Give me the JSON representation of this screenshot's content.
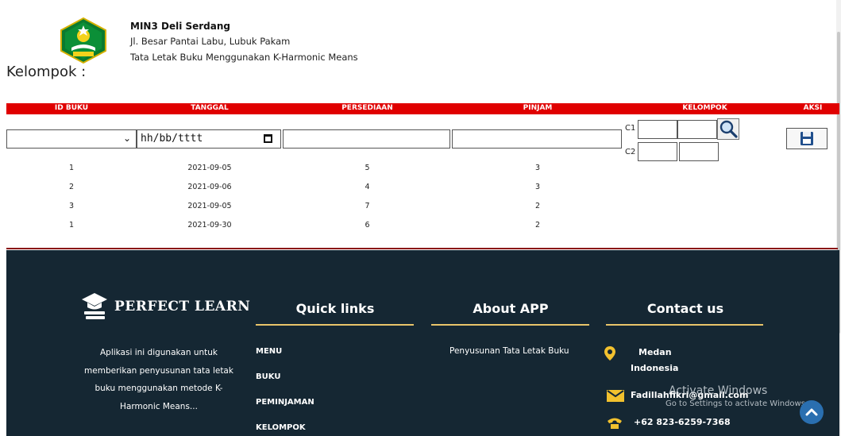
{
  "header": {
    "school_name": "MIN3 Deli Serdang",
    "address": "Jl. Besar Pantai Labu, Lubuk Pakam",
    "app_title": "Tata Letak Buku Menggunakan K-Harmonic Means",
    "section_heading": "Kelompok :"
  },
  "table": {
    "columns": [
      "ID BUKU",
      "TANGGAL",
      "PERSEDIAAN",
      "PINJAM",
      "KELOMPOK",
      "AKSI"
    ],
    "form": {
      "id_value": "",
      "date_placeholder": "hh/bb/tttt",
      "stock_value": "",
      "loan_value": "",
      "c1_label": "C1",
      "c2_label": "C2"
    },
    "rows": [
      {
        "id": "1",
        "date": "2021-09-05",
        "stock": "5",
        "loan": "3"
      },
      {
        "id": "2",
        "date": "2021-09-06",
        "stock": "4",
        "loan": "3"
      },
      {
        "id": "3",
        "date": "2021-09-05",
        "stock": "7",
        "loan": "2"
      },
      {
        "id": "1",
        "date": "2021-09-30",
        "stock": "6",
        "loan": "2"
      }
    ]
  },
  "footer": {
    "brand": "PERFECT LEARN",
    "description": "Aplikasi ini digunakan untuk memberikan penyusunan tata letak buku menggunakan metode K-Harmonic Means...",
    "quick_links_title": "Quick links",
    "quick_links": [
      "MENU",
      "BUKU",
      "PEMINJAMAN",
      "KELOMPOK"
    ],
    "about_title": "About APP",
    "about_text": "Penyusunan Tata Letak Buku",
    "contact_title": "Contact us",
    "contact": {
      "city": "Medan",
      "country": "Indonesia",
      "email": "Fadillahfikri@gmail.com",
      "phone": "+62 823-6259-7368"
    },
    "accent_color": "#e9c46a",
    "background_color": "#152733"
  },
  "system": {
    "activate_title": "Activate Windows",
    "activate_sub": "Go to Settings to activate Windows."
  },
  "icons": {
    "logo": "ministry-emblem-icon",
    "search": "search-icon",
    "save": "floppy-disk-icon",
    "calendar": "calendar-icon",
    "location": "map-pin-icon",
    "email": "envelope-icon",
    "phone": "telephone-icon",
    "to_top": "chevron-up-icon"
  }
}
